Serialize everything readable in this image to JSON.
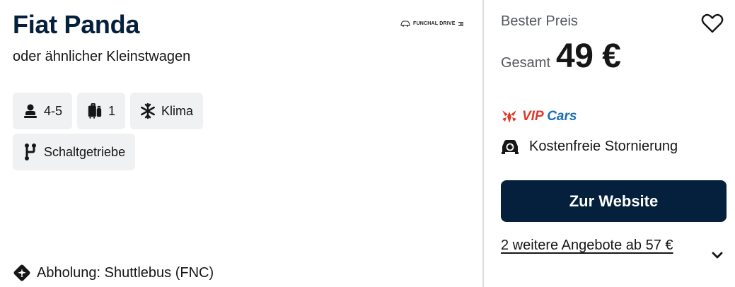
{
  "car": {
    "title": "Fiat Panda",
    "subtitle": "oder ähnlicher Kleinstwagen"
  },
  "supplier": {
    "logo_text": "FUNCHAL DRIVE"
  },
  "features": [
    {
      "icon": "person-seat-icon",
      "label": "4-5"
    },
    {
      "icon": "luggage-icon",
      "label": "1"
    },
    {
      "icon": "snowflake-icon",
      "label": "Klima"
    },
    {
      "icon": "gearshift-icon",
      "label": "Schaltgetriebe"
    }
  ],
  "pickup": {
    "icon": "plane-pin-icon",
    "label": "Abholung: Shuttlebus (FNC)"
  },
  "offer": {
    "best_price_label": "Bester Preis",
    "total_label": "Gesamt",
    "price": "49 €",
    "provider_name": "VIP Cars",
    "provider_prefix": "VIP",
    "provider_suffix": "Cars",
    "cancellation": "Kostenfreie Stornierung",
    "cta_label": "Zur Website",
    "more_offers": "2 weitere Angebote ab 57 €"
  },
  "colors": {
    "brand_dark": "#05203c",
    "chip_bg": "#eff1f2",
    "muted_text": "#545860",
    "vip_blue": "#1a6fb5",
    "vip_red": "#e0392a"
  }
}
